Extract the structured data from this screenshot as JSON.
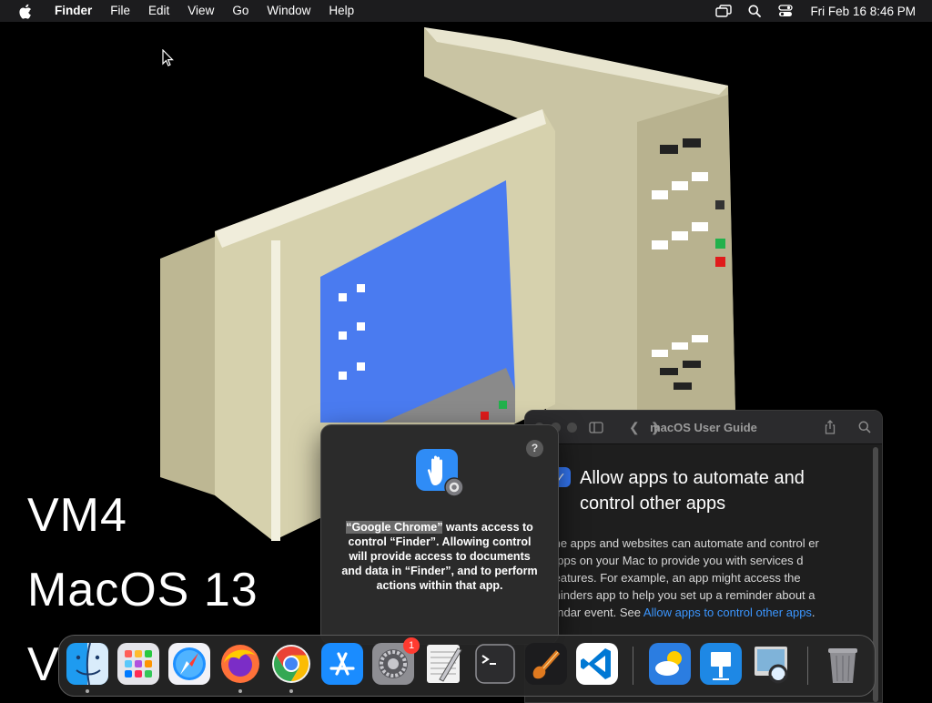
{
  "menubar": {
    "apple_icon": "apple-icon",
    "app_name": "Finder",
    "menus": [
      "File",
      "Edit",
      "View",
      "Go",
      "Window",
      "Help"
    ],
    "status_icons": [
      "screen-mirroring-icon",
      "spotlight-search-icon",
      "control-center-icon"
    ],
    "clock": "Fri Feb 16  8:46 PM"
  },
  "wallpaper": {
    "line1": "VM4",
    "line2": "MacOS 13",
    "line3": "V"
  },
  "guide": {
    "title": "macOS User Guide",
    "heading": "Allow apps to automate and control other apps",
    "body": "me apps and websites can automate and control er apps on your Mac to provide you with services d features. For example, an app might access the minders app to help you set up a reminder about a endar event. See ",
    "link": "Allow apps to control other apps",
    "body_end": "."
  },
  "dialog": {
    "help_label": "?",
    "app_quoted": "“Google Chrome”",
    "message": " wants access to control “Finder”. Allowing control will provide access to documents and data in “Finder”, and to perform actions within that app."
  },
  "dock": {
    "items": [
      {
        "name": "Finder",
        "icon": "finder-icon",
        "running": true
      },
      {
        "name": "Launchpad",
        "icon": "launchpad-icon",
        "running": false
      },
      {
        "name": "Safari",
        "icon": "safari-icon",
        "running": false
      },
      {
        "name": "Firefox",
        "icon": "firefox-icon",
        "running": true
      },
      {
        "name": "Google Chrome",
        "icon": "chrome-icon",
        "running": true
      },
      {
        "name": "App Store",
        "icon": "app-store-icon",
        "running": false
      },
      {
        "name": "System Settings",
        "icon": "system-settings-icon",
        "running": false,
        "badge": "1"
      },
      {
        "name": "Script Editor",
        "icon": "script-editor-icon",
        "running": false
      },
      {
        "name": "Terminal",
        "icon": "terminal-icon",
        "running": false
      },
      {
        "name": "GarageBand",
        "icon": "garageband-icon",
        "running": false
      },
      {
        "name": "Visual Studio Code",
        "icon": "vscode-icon",
        "running": false
      },
      {
        "name": "Weather",
        "icon": "weather-icon",
        "running": false
      },
      {
        "name": "Keynote",
        "icon": "keynote-icon",
        "running": false
      },
      {
        "name": "Preview",
        "icon": "preview-icon",
        "running": false
      },
      {
        "name": "Trash",
        "icon": "trash-icon",
        "running": false
      }
    ]
  }
}
